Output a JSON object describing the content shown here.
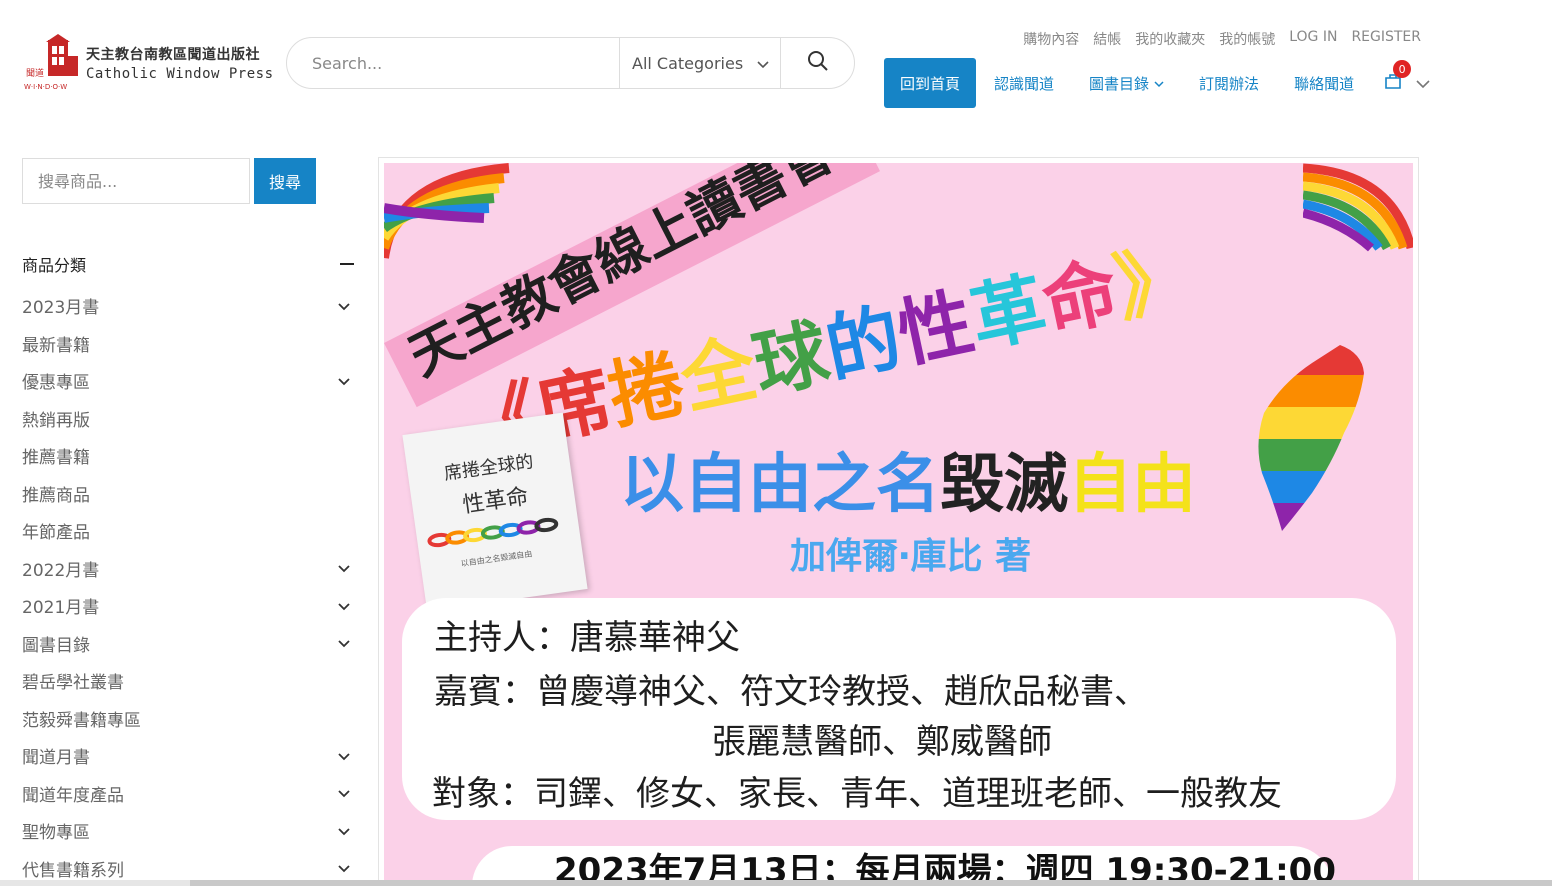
{
  "logo": {
    "cn": "天主教台南教區聞道出版社",
    "en": "Catholic Window Press",
    "mark_small": "聞道",
    "mark_word": "W·I·N·D·O·W"
  },
  "search": {
    "placeholder": "Search...",
    "category": "All Categories"
  },
  "toplinks": [
    "購物內容",
    "結帳",
    "我的收藏夾",
    "我的帳號",
    "LOG IN",
    "REGISTER"
  ],
  "nav": {
    "home": "回到首頁",
    "items": [
      "認識聞道",
      "圖書目錄",
      "訂閱辦法",
      "聯絡聞道"
    ],
    "cart_count": "0"
  },
  "sidebar": {
    "search_placeholder": "搜尋商品...",
    "search_button": "搜尋",
    "category_title": "商品分類",
    "categories": [
      {
        "label": "2023月書",
        "expand": true
      },
      {
        "label": "最新書籍",
        "expand": false
      },
      {
        "label": "優惠專區",
        "expand": true
      },
      {
        "label": "熱銷再版",
        "expand": false
      },
      {
        "label": "推薦書籍",
        "expand": false
      },
      {
        "label": "推薦商品",
        "expand": false
      },
      {
        "label": "年節產品",
        "expand": false
      },
      {
        "label": "2022月書",
        "expand": true
      },
      {
        "label": "2021月書",
        "expand": true
      },
      {
        "label": "圖書目錄",
        "expand": true
      },
      {
        "label": "碧岳學社叢書",
        "expand": false
      },
      {
        "label": "范毅舜書籍專區",
        "expand": false
      },
      {
        "label": "聞道月書",
        "expand": true
      },
      {
        "label": "聞道年度產品",
        "expand": true
      },
      {
        "label": "聖物專區",
        "expand": true
      },
      {
        "label": "代售書籍系列",
        "expand": true
      }
    ]
  },
  "banner": {
    "event": "天主教會線上讀書會",
    "title_open": "《",
    "title_chars": [
      "席",
      "捲",
      "全",
      "球",
      "的",
      "性",
      "革",
      "命"
    ],
    "title_close": "》",
    "subtitle_a": "以自由之名",
    "subtitle_b": "毀滅",
    "subtitle_c": "自由",
    "author": "加俾爾‧庫比 著",
    "book_title1": "席捲全球的",
    "book_title2": "性革命",
    "book_sub": "以自由之名毀滅自由",
    "host": "主持人：唐慕華神父",
    "guests_1": "嘉賓：曾慶導神父、符文玲教授、趙欣品秘書、",
    "guests_2": "張麗慧醫師、鄭威醫師",
    "audience": "對象：司鐸、修女、家長、青年、道理班老師、一般教友",
    "date_line": "2023年7月13日；每月兩場：週四 19:30-21:00",
    "colors": [
      "#e53935",
      "#fb8c00",
      "#fdd835",
      "#43a047",
      "#1e88e5",
      "#8e24aa",
      "#26c6da",
      "#ec407a"
    ]
  }
}
